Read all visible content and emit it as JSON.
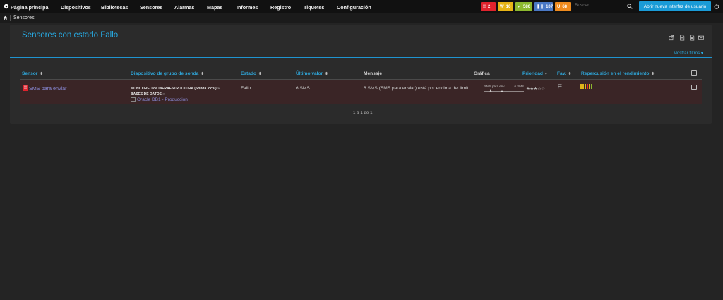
{
  "topnav": {
    "items": [
      "Página principal",
      "Dispositivos",
      "Bibliotecas",
      "Sensores",
      "Alarmas",
      "Mapas",
      "Informes",
      "Registro",
      "Tiquetes",
      "Configuración"
    ],
    "badges": [
      {
        "icon": "error-icon",
        "value": "2",
        "color": "#e0232d"
      },
      {
        "icon": "warning-icon",
        "value": "16",
        "color": "#e7b416"
      },
      {
        "icon": "check-icon",
        "value": "580",
        "color": "#8cb82f"
      },
      {
        "icon": "pause-icon",
        "value": "107",
        "color": "#4a78c4"
      },
      {
        "icon": "unusual-icon",
        "value": "68",
        "color": "#ef8b1e"
      }
    ],
    "search_placeholder": "Buscar...",
    "new_ui_label": "Abrir nueva interfaz de usuario"
  },
  "breadcrumb": {
    "current": "Sensores"
  },
  "page": {
    "title": "Sensores con estado Fallo",
    "filter_link": "Mostrar filtros ▾",
    "tools": [
      "external-link-icon",
      "pdf-icon",
      "csv-icon",
      "email-icon"
    ]
  },
  "table": {
    "headers": {
      "sensor": "Sensor",
      "device": "Dispositivo de grupo de sonda",
      "state": "Estado",
      "last_value": "Último valor",
      "message": "Mensaje",
      "graph": "Gráfica",
      "priority": "Prioridad",
      "fav": "Fav.",
      "impact": "Repercusión en el rendimiento"
    },
    "rows": [
      {
        "sensor": "SMS para enviar",
        "device_probe": "MONITOREO de INFRAESTRUCTURA (Sonda local)",
        "device_group": "BASES DE DATOS",
        "device_name": "Oracle DB1 - Produccion",
        "state": "Fallo",
        "last_value": "6 SMS",
        "message": "6 SMS (SMS para enviar) está por encima del límit...",
        "graph_label": "SMS para env...",
        "graph_value": "6 SMS",
        "priority": "★★★☆☆",
        "impact_colors": [
          "#e0b31a",
          "#e0b31a",
          "#e0b31a",
          "#e0232d",
          "#e0b31a",
          "#8cb82f"
        ]
      }
    ]
  },
  "pager": "1 a 1 de 1"
}
